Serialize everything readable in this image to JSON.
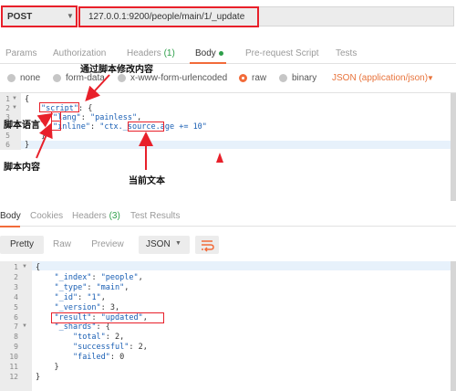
{
  "request": {
    "method": "POST",
    "url": "127.0.0.1:9200/people/main/1/_update"
  },
  "request_tabs": {
    "params": "Params",
    "authorization": "Authorization",
    "headers": "Headers",
    "headers_count": "(1)",
    "body": "Body",
    "prerequest": "Pre-request Script",
    "tests": "Tests"
  },
  "body_types": {
    "none": "none",
    "form_data": "form-data",
    "urlencoded": "x-www-form-urlencoded",
    "raw": "raw",
    "binary": "binary",
    "json": "JSON (application/json)"
  },
  "request_body": {
    "line_numbers": [
      "1",
      "2",
      "3",
      "4",
      "5",
      "6"
    ],
    "l1": "{",
    "l2_key": "\"script\"",
    "l2_rest": ": {",
    "l3_key": "\"lang\"",
    "l3_sep": ": ",
    "l3_val": "\"painless\"",
    "l3_end": ",",
    "l4_key": "\"inline\"",
    "l4_sep": ": ",
    "l4_val_a": "\"ctx.",
    "l4_val_b": "_source",
    "l4_val_c": ".age += 10\"",
    "l5": "}",
    "l6": "}"
  },
  "annotations": {
    "modify_via_script": "通过脚本修改内容",
    "script_language": "脚本语言",
    "script_content": "脚本内容",
    "current_document": "当前文本"
  },
  "response_tabs": {
    "body": "Body",
    "cookies": "Cookies",
    "headers": "Headers",
    "headers_count": "(3)",
    "test_results": "Test Results"
  },
  "response_toolbar": {
    "pretty": "Pretty",
    "raw": "Raw",
    "preview": "Preview",
    "format": "JSON"
  },
  "response_body": {
    "line_numbers": [
      "1",
      "2",
      "3",
      "4",
      "5",
      "6",
      "7",
      "8",
      "9",
      "10",
      "11",
      "12"
    ],
    "lines": [
      "{",
      "    \"_index\": \"people\",",
      "    \"_type\": \"main\",",
      "    \"_id\": \"1\",",
      "    \"_version\": 3,",
      "    \"result\": \"updated\",",
      "    \"_shards\": {",
      "        \"total\": 2,",
      "        \"successful\": 2,",
      "        \"failed\": 0",
      "    }",
      "}"
    ]
  },
  "colors": {
    "accent": "#f26b3a",
    "highlight_box": "#e8202a",
    "count_green": "#2e9f4a",
    "string_blue": "#1a5fb4"
  }
}
